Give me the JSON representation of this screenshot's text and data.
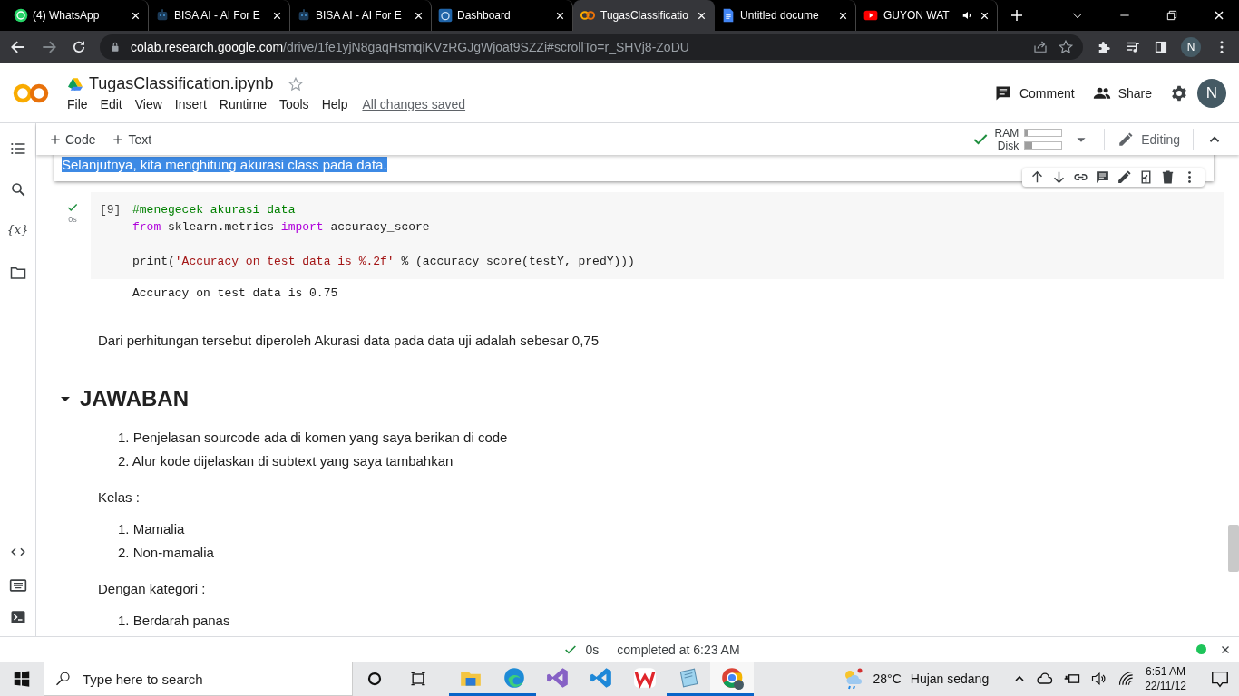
{
  "browser": {
    "tabs": [
      {
        "title": "(4) WhatsApp",
        "kind": "whatsapp",
        "selected": false,
        "audio": false
      },
      {
        "title": "BISA AI - AI For E",
        "kind": "bisa",
        "selected": false,
        "audio": false
      },
      {
        "title": "BISA AI - AI For E",
        "kind": "bisa",
        "selected": false,
        "audio": false
      },
      {
        "title": "Dashboard",
        "kind": "dashboard",
        "selected": false,
        "audio": false
      },
      {
        "title": "TugasClassificatio",
        "kind": "colab",
        "selected": true,
        "audio": false
      },
      {
        "title": "Untitled docume",
        "kind": "docs",
        "selected": false,
        "audio": false
      },
      {
        "title": "GUYON WAT",
        "kind": "youtube",
        "selected": false,
        "audio": true
      }
    ],
    "url": {
      "host": "colab.research.google.com",
      "path": "/drive/1fe1yjN8gaqHsmqiKVzRGJgWjoat9SZZi#scrollTo=r_SHVj8-ZoDU"
    },
    "profile": "N"
  },
  "colab": {
    "file_name": "TugasClassification.ipynb",
    "starred": false,
    "menu": [
      "File",
      "Edit",
      "View",
      "Insert",
      "Runtime",
      "Tools",
      "Help"
    ],
    "save_status": "All changes saved",
    "actions": [
      {
        "kind": "comment",
        "label": "Comment"
      },
      {
        "kind": "share",
        "label": "Share"
      }
    ],
    "avatar": "N"
  },
  "toolbar": {
    "add": [
      "Code",
      "Text"
    ],
    "connected": true,
    "resources": [
      {
        "label": "RAM",
        "level": 0.06
      },
      {
        "label": "Disk",
        "level": 0.2
      }
    ],
    "mode": "Editing"
  },
  "rail": {
    "variables": "{x}"
  },
  "cells": [
    {
      "kind": "text",
      "selected": true,
      "text": "Selanjutnya, kita menghitung akurasi class pada data."
    },
    {
      "kind": "code",
      "count": "[9]",
      "duration": "0s",
      "lines": [
        [
          {
            "t": "#menegecek akurasi data",
            "kind": "comment"
          }
        ],
        [
          {
            "t": "from",
            "kind": "keyword"
          },
          {
            "t": " sklearn.metrics ",
            "kind": "plain"
          },
          {
            "t": "import",
            "kind": "keyword"
          },
          {
            "t": " accuracy_score",
            "kind": "plain"
          }
        ],
        [
          {
            "t": "print(",
            "kind": "plain",
            "gap": true
          },
          {
            "t": "'Accuracy on test data is %.2f'",
            "kind": "string"
          },
          {
            "t": " % (accuracy_score(testY, predY)))",
            "kind": "plain"
          }
        ]
      ],
      "output": "Accuracy on test data is 0.75"
    },
    {
      "kind": "paragraph",
      "text": "Dari perhitungan tersebut diperoleh Akurasi data pada data uji adalah sebesar 0,75"
    },
    {
      "kind": "heading",
      "text": "JAWABAN",
      "expanded": true
    },
    {
      "kind": "list",
      "items": [
        {
          "number": "1.",
          "text": "Penjelasan sourcode ada di komen yang saya berikan di code"
        },
        {
          "number": "2.",
          "text": "Alur kode dijelaskan di subtext yang saya tambahkan"
        }
      ]
    },
    {
      "kind": "paragraph",
      "text": "Kelas :"
    },
    {
      "kind": "list",
      "items": [
        {
          "number": "1.",
          "text": "Mamalia"
        },
        {
          "number": "2.",
          "text": "Non-mamalia"
        }
      ]
    },
    {
      "kind": "paragraph",
      "text": "Dengan kategori :"
    },
    {
      "kind": "list",
      "items": [
        {
          "number": "1.",
          "text": "Berdarah panas"
        }
      ]
    }
  ],
  "status": {
    "duration": "0s",
    "message": "completed at 6:23 AM",
    "connected": true
  },
  "taskbar": {
    "search_placeholder": "Type here to search",
    "apps": [
      {
        "kind": "explorer",
        "active": false,
        "open": true
      },
      {
        "kind": "edge",
        "active": false,
        "open": true
      },
      {
        "kind": "vs",
        "active": false,
        "open": false
      },
      {
        "kind": "vscode",
        "active": false,
        "open": false
      },
      {
        "kind": "wps",
        "active": false,
        "open": false
      },
      {
        "kind": "notepad",
        "active": false,
        "open": true
      },
      {
        "kind": "chrome",
        "active": true,
        "open": true
      }
    ],
    "temperature": "28°C",
    "weather": "Hujan sedang",
    "time": "6:51 AM",
    "date": "22/11/12"
  }
}
